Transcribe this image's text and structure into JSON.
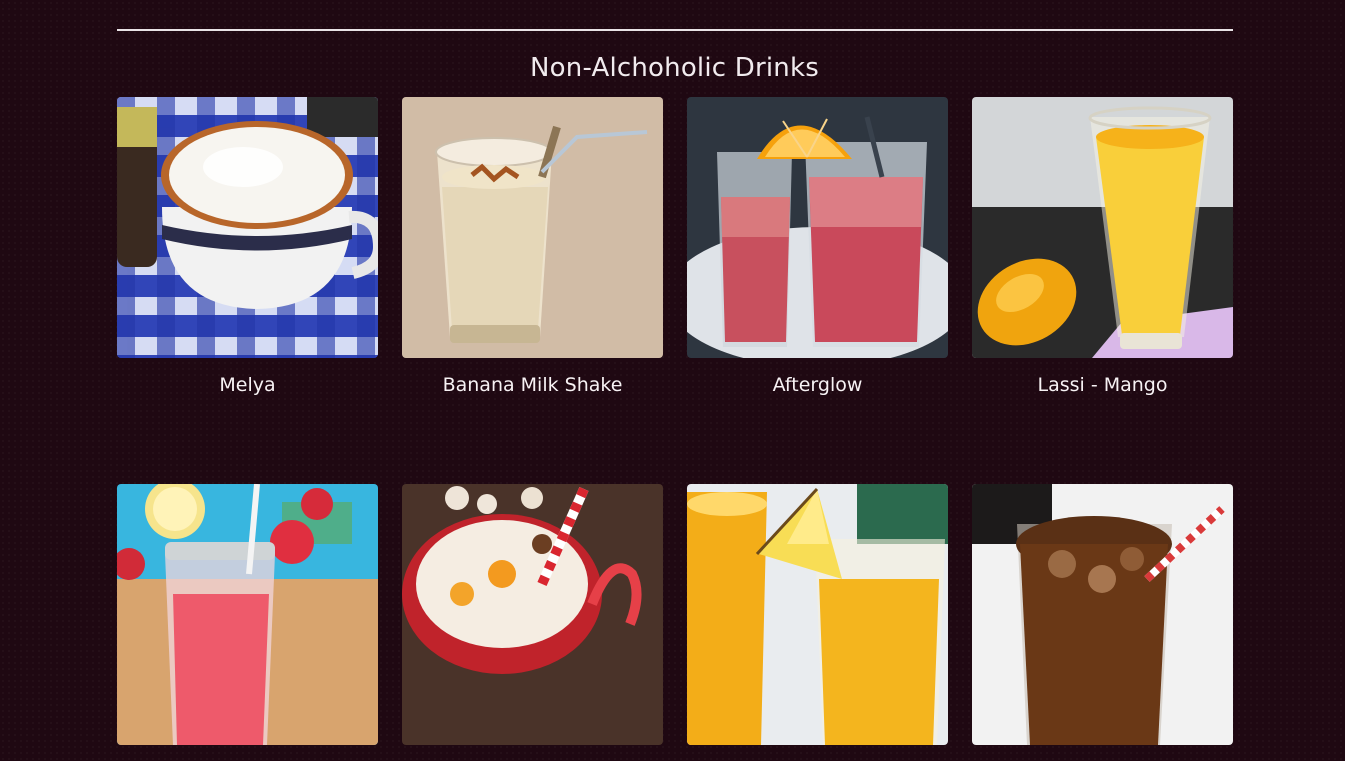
{
  "section": {
    "title": "Non-Alchoholic Drinks"
  },
  "drinks": [
    {
      "name": "Melya",
      "image": "melya-photo"
    },
    {
      "name": "Banana Milk Shake",
      "image": "banana-milk-shake-photo"
    },
    {
      "name": "Afterglow",
      "image": "afterglow-photo"
    },
    {
      "name": "Lassi - Mango",
      "image": "lassi-mango-photo"
    },
    {
      "name": "",
      "image": "strawberry-drink-photo"
    },
    {
      "name": "",
      "image": "hot-cocoa-photo"
    },
    {
      "name": "",
      "image": "pineapple-juice-photo"
    },
    {
      "name": "",
      "image": "iced-tea-photo"
    }
  ],
  "colors": {
    "background": "#1f0812",
    "text": "#f4eef1",
    "divider": "#e9e3e6"
  }
}
